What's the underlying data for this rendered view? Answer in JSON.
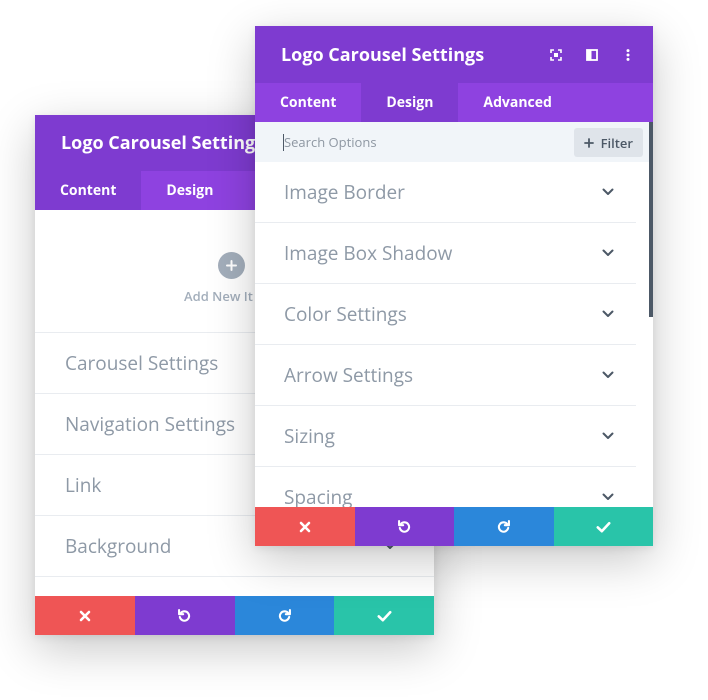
{
  "back_modal": {
    "title": "Logo Carousel Settings",
    "tabs": [
      "Content",
      "Design"
    ],
    "add_new_label": "Add New It",
    "options": [
      "Carousel Settings",
      "Navigation Settings",
      "Link",
      "Background"
    ]
  },
  "front_modal": {
    "title": "Logo Carousel Settings",
    "tabs": [
      "Content",
      "Design",
      "Advanced"
    ],
    "active_tab": "Design",
    "search": {
      "placeholder": "Search Options",
      "value": ""
    },
    "filter_label": "Filter",
    "options": [
      "Image Border",
      "Image Box Shadow",
      "Color Settings",
      "Arrow Settings",
      "Sizing",
      "Spacing"
    ]
  },
  "footer_buttons": [
    "close",
    "undo",
    "redo",
    "save"
  ],
  "colors": {
    "purple_dark": "#7e3bd0",
    "purple_light": "#8e42e0",
    "red": "#ef5555",
    "blue": "#2b87da",
    "teal": "#29c4a9"
  },
  "icons": [
    "fullscreen-icon",
    "split-view-icon",
    "more-options-icon",
    "plus-icon",
    "chevron-down-icon",
    "close-icon",
    "undo-icon",
    "redo-icon",
    "checkmark-icon"
  ]
}
